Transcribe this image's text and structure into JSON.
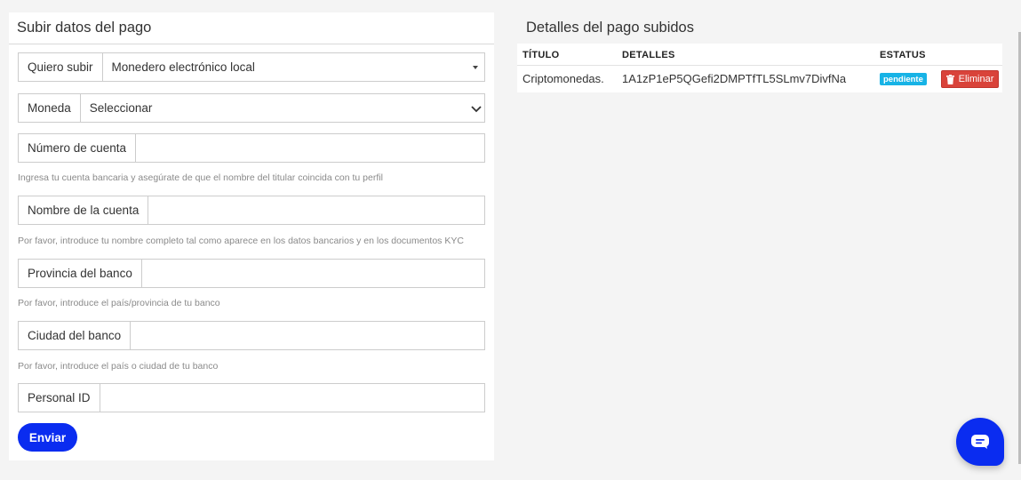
{
  "form": {
    "title": "Subir datos del pago",
    "fields": [
      {
        "label": "Quiero subir",
        "value": "Monedero electrónico local"
      },
      {
        "label": "Moneda",
        "value": "Seleccionar"
      },
      {
        "label": "Número de cuenta",
        "value": "",
        "help": "Ingresa tu cuenta bancaria y asegúrate de que el nombre del titular coincida con tu perfil"
      },
      {
        "label": "Nombre de la cuenta",
        "value": "",
        "help": "Por favor, introduce tu nombre completo tal como aparece en los datos bancarios y en los documentos KYC"
      },
      {
        "label": "Provincia del banco",
        "value": "",
        "help": "Por favor, introduce el país/provincia de tu banco"
      },
      {
        "label": "Ciudad del banco",
        "value": "",
        "help": "Por favor, introduce el país o ciudad de tu banco"
      },
      {
        "label": "Personal ID",
        "value": ""
      }
    ],
    "submit_label": "Enviar"
  },
  "details": {
    "title": "Detalles del pago subidos",
    "columns": [
      "TÍTULO",
      "DETALLES",
      "ESTATUS"
    ],
    "rows": [
      {
        "title": "Criptomonedas.",
        "details": "1A1zP1eP5QGefi2DMPTfTL5SLmv7DivfNa",
        "status": "pendiente",
        "action": "Eliminar"
      }
    ]
  },
  "colors": {
    "primary": "#0a2cf0",
    "status_pending": "#17b3e6",
    "danger": "#d9433a"
  },
  "icons": {
    "delete": "trash-icon",
    "chat": "chat-icon"
  }
}
